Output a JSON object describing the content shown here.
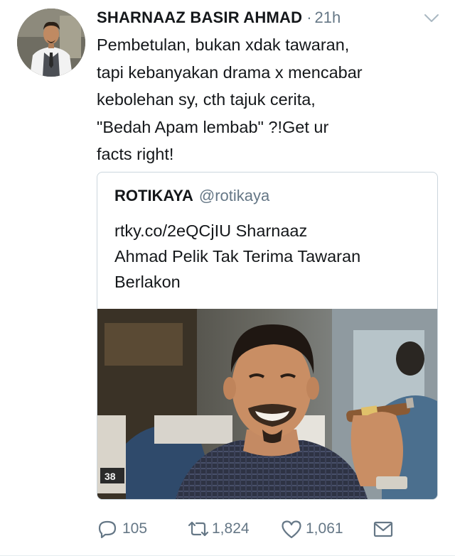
{
  "tweet": {
    "author_name": "SHARNAAZ BASIR AHMAD",
    "separator": "·",
    "timestamp": "21h",
    "lines": [
      "Pembetulan, bukan xdak tawaran,",
      "tapi kebanyakan drama x mencabar",
      "kebolehan sy, cth tajuk cerita,",
      "\"Bedah Apam lembab\" ?!Get ur",
      "facts right!"
    ]
  },
  "quote": {
    "name": "ROTIKAYA",
    "handle": "@rotikaya",
    "lines": [
      "rtky.co/2eQCjIU Sharnaaz",
      "Ahmad Pelik Tak Terima Tawaran",
      "Berlakon"
    ],
    "image_alt": "Photo of a smiling man holding a cigar",
    "table_number": "38"
  },
  "actions": {
    "replies": "105",
    "retweets": "1,824",
    "likes": "1,061"
  },
  "icons": {
    "caret": "chevron-down-icon",
    "reply": "reply-icon",
    "retweet": "retweet-icon",
    "like": "heart-icon",
    "dm": "envelope-icon"
  },
  "colors": {
    "text": "#14171a",
    "muted": "#657786",
    "border": "#ccd6dd"
  }
}
